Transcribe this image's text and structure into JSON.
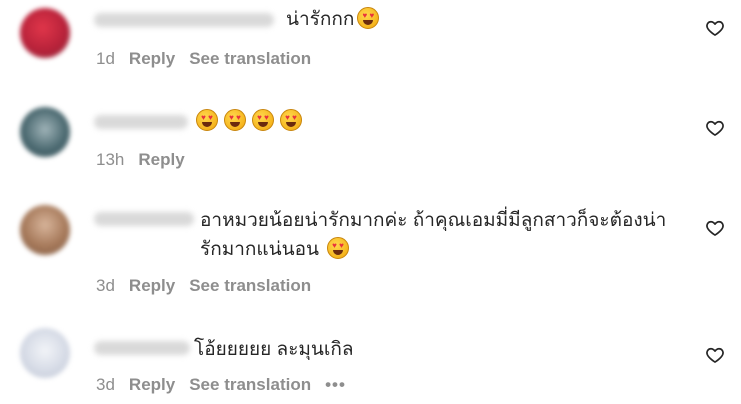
{
  "comments": [
    {
      "text": "น่ารักกก",
      "emoji_count": 1,
      "time": "1d",
      "reply_label": "Reply",
      "translation_label": "See translation"
    },
    {
      "text": "",
      "emoji_count": 4,
      "time": "13h",
      "reply_label": "Reply"
    },
    {
      "text_line1": "อาหมวยน้อยน่ารักมากค่ะ ถ้าคุณเอมมี่มีลูกสาวก็จะต้องน่า",
      "text_line2": "รักมากแน่นอน",
      "emoji_count": 1,
      "time": "3d",
      "reply_label": "Reply",
      "translation_label": "See translation"
    },
    {
      "text": "โอ้ยยยยย ละมุนเกิล",
      "time": "3d",
      "reply_label": "Reply",
      "translation_label": "See translation",
      "more_label": "•••"
    }
  ],
  "icons": {
    "like": "heart-outline-icon",
    "emoji": "heart-eyes-emoji-icon",
    "more": "more-options-icon"
  },
  "colors": {
    "text": "#262626",
    "secondary": "#8e8e8e",
    "emoji_eyes": "#e8323c"
  }
}
